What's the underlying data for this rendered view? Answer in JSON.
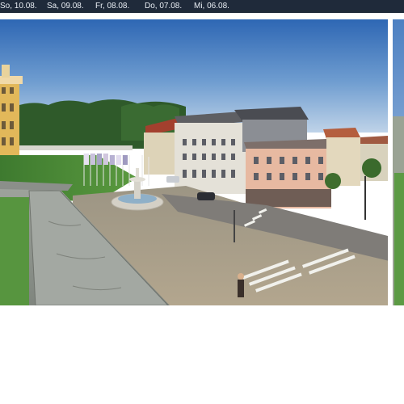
{
  "date_bar": {
    "tabs": [
      {
        "label": "So, 10.08."
      },
      {
        "label": "Sa, 09.08."
      },
      {
        "label": "Fr, 08.08."
      },
      {
        "label": "Do, 07.08."
      },
      {
        "label": "Mi, 06.08."
      }
    ]
  },
  "webcam": {
    "scene": "town-square-panorama",
    "colors": {
      "sky_top": "#2e67b4",
      "sky_bottom": "#bfd3e8",
      "pavement": "#a89c86",
      "lawn": "#4d8a3a",
      "bar_bg": "#1f2a3a"
    }
  }
}
